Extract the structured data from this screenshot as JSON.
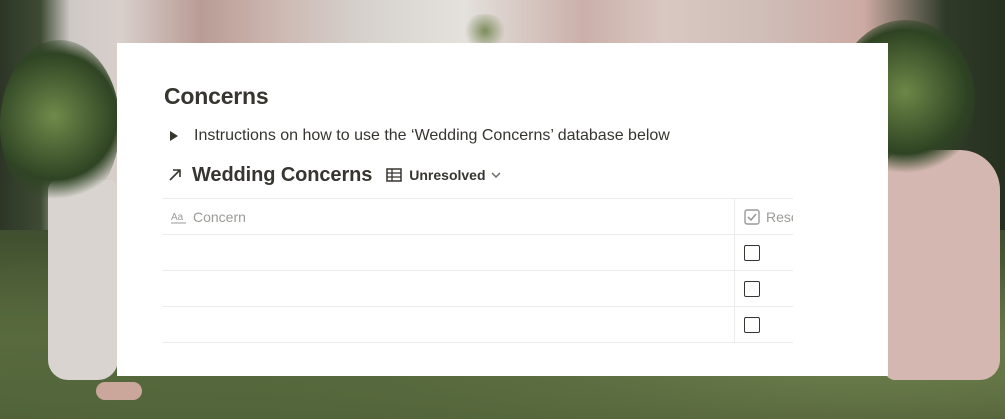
{
  "page": {
    "title": "Concerns"
  },
  "toggle": {
    "label": "Instructions on how to use the ‘Wedding Concerns’ database below"
  },
  "database": {
    "title": "Wedding Concerns",
    "view_label": "Unresolved"
  },
  "table": {
    "columns": [
      "Concern",
      "Reso"
    ],
    "column_icons": [
      "text-icon",
      "checkbox-property-icon"
    ],
    "rows": [
      {
        "concern": "",
        "resolved": false
      },
      {
        "concern": "",
        "resolved": false
      },
      {
        "concern": "",
        "resolved": false
      }
    ]
  }
}
